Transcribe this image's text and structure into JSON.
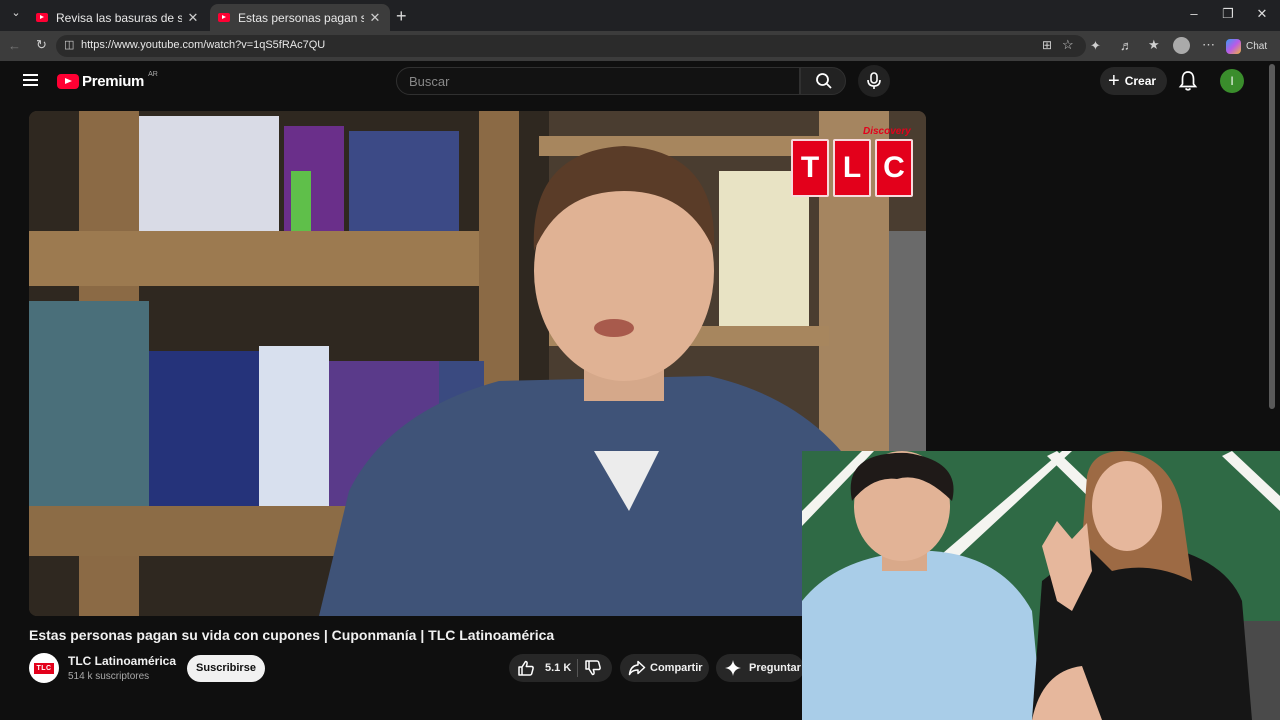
{
  "browser": {
    "tabs": [
      {
        "title": "Revisa las basuras de sus amigos p",
        "active": false
      },
      {
        "title": "Estas personas pagan su vida con c",
        "active": true
      }
    ],
    "url": "https://www.youtube.com/watch?v=1qS5fRAc7QU",
    "chat_label": "Chat"
  },
  "youtube": {
    "logo_text": "Premium",
    "country_code": "AR",
    "search_placeholder": "Buscar",
    "create_label": "Crear",
    "avatar_letter": "I"
  },
  "video": {
    "title": "Estas personas pagan su vida con cupones | Cuponmanía | TLC Latinoamérica",
    "tlc_letters": [
      "T",
      "L",
      "C"
    ],
    "tlc_brand": "Discovery",
    "channel": {
      "name": "TLC Latinoamérica",
      "subscribers": "514 k suscriptores",
      "avatar_text": "TLC"
    },
    "subscribe_label": "Suscribirse",
    "likes": "5.1 K",
    "share_label": "Compartir",
    "ask_label": "Preguntar"
  },
  "colors": {
    "youtube_red": "#ff0033",
    "tlc_red": "#e3001b",
    "background": "#0f0f0f"
  }
}
